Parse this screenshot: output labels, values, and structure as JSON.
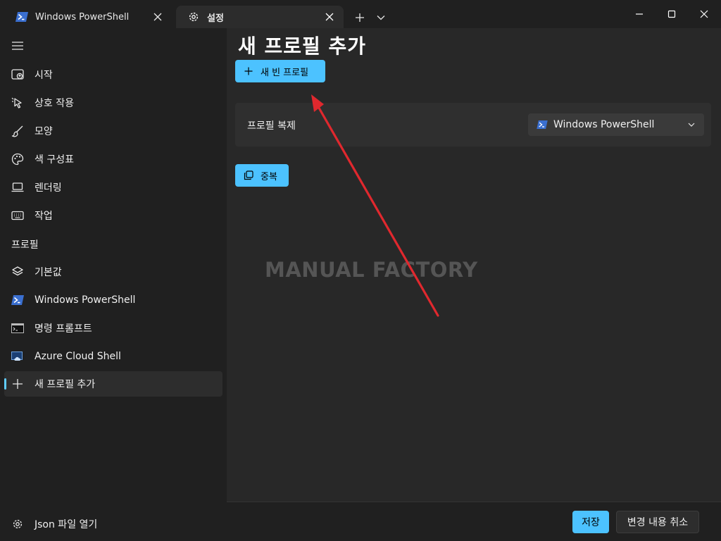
{
  "tabs": [
    {
      "label": "Windows PowerShell",
      "icon": "powershell-icon",
      "active": false
    },
    {
      "label": "설정",
      "icon": "gear-icon",
      "active": true
    }
  ],
  "sidebar": {
    "items": [
      {
        "label": "시작",
        "icon": "startup-icon"
      },
      {
        "label": "상호 작용",
        "icon": "interaction-cursor-icon"
      },
      {
        "label": "모양",
        "icon": "paintbrush-icon"
      },
      {
        "label": "색 구성표",
        "icon": "palette-icon"
      },
      {
        "label": "렌더링",
        "icon": "laptop-icon"
      },
      {
        "label": "작업",
        "icon": "keyboard-icon"
      }
    ],
    "section_label": "프로필",
    "profiles": [
      {
        "label": "기본값",
        "icon": "layers-icon"
      },
      {
        "label": "Windows PowerShell",
        "icon": "powershell-icon"
      },
      {
        "label": "명령 프롬프트",
        "icon": "cmd-icon"
      },
      {
        "label": "Azure Cloud Shell",
        "icon": "azure-icon"
      },
      {
        "label": "새 프로필 추가",
        "icon": "plus-icon",
        "selected": true
      }
    ],
    "footer_label": "Json 파일 열기"
  },
  "main": {
    "title": "새 프로필 추가",
    "new_empty_label": "새 빈 프로필",
    "duplicate_card": {
      "label": "프로필 복제",
      "selected_value": "Windows PowerShell"
    },
    "duplicate_label": "중복"
  },
  "watermark": "MANUAL FACTORY",
  "footer": {
    "save_label": "저장",
    "discard_label": "변경 내용 취소"
  },
  "colors": {
    "accent": "#4cc2ff",
    "background": "#202020",
    "content": "#282828",
    "annotation_arrow": "#e0282e"
  }
}
